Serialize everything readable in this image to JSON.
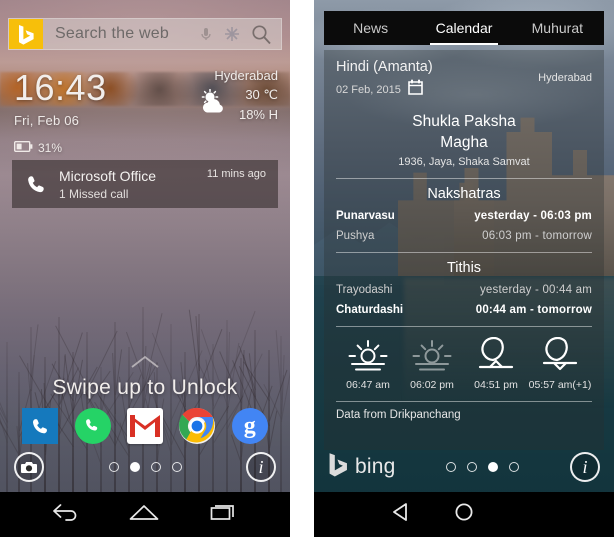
{
  "left_phone": {
    "search": {
      "placeholder": "Search the web",
      "logo": "bing-logo"
    },
    "clock": {
      "time": "16:43",
      "date": "Fri, Feb 06",
      "battery": "31%"
    },
    "weather": {
      "city": "Hyderabad",
      "temperature": "30 ℃",
      "humidity": "18% H",
      "icon": "sun-behind-cloud-icon"
    },
    "notification": {
      "title": "Microsoft Office",
      "subtitle": "1 Missed call",
      "time": "11 mins ago",
      "icon": "phone-icon"
    },
    "unlock_text": "Swipe up to Unlock",
    "apps": [
      {
        "name": "phone",
        "label": "Phone"
      },
      {
        "name": "whatsapp",
        "label": "WhatsApp"
      },
      {
        "name": "gmail",
        "label": "Gmail"
      },
      {
        "name": "chrome",
        "label": "Chrome"
      },
      {
        "name": "google",
        "label": "Google"
      }
    ],
    "bottom": {
      "left_icon": "camera-icon",
      "right_icon": "info-icon",
      "dots": 4,
      "active_dot": 2
    },
    "navbar": {
      "back": "back-icon",
      "home": "home-icon",
      "recents": "recents-icon"
    }
  },
  "right_phone": {
    "tabs": [
      {
        "label": "News",
        "active": false
      },
      {
        "label": "Calendar",
        "active": true
      },
      {
        "label": "Muhurat",
        "active": false
      }
    ],
    "panchang": {
      "language": "Hindi (Amanta)",
      "date": "02 Feb, 2015",
      "calendar_icon": "calendar-icon",
      "city": "Hyderabad",
      "paksha": "Shukla Paksha",
      "month": "Magha",
      "samvat": "1936, Jaya, Shaka Samvat",
      "nakshatras_title": "Nakshatras",
      "nakshatras": [
        {
          "name": "Punarvasu",
          "time": "yesterday  -  06:03 pm",
          "highlight": true
        },
        {
          "name": "Pushya",
          "time": "06:03 pm  -  tomorrow",
          "highlight": false
        }
      ],
      "tithis_title": "Tithis",
      "tithis": [
        {
          "name": "Trayodashi",
          "time": "yesterday  -  00:44 am",
          "highlight": false
        },
        {
          "name": "Chaturdashi",
          "time": "00:44 am  -  tomorrow",
          "highlight": true
        }
      ],
      "astro": [
        {
          "icon": "sunrise-icon",
          "time": "06:47 am"
        },
        {
          "icon": "sunset-icon",
          "time": "06:02 pm"
        },
        {
          "icon": "moonrise-icon",
          "time": "04:51 pm"
        },
        {
          "icon": "moonset-icon",
          "time": "05:57 am(+1)"
        }
      ],
      "source": "Data from Drikpanchang"
    },
    "bottom": {
      "brand": "bing",
      "brand_icon": "bing-logo",
      "right_icon": "info-icon",
      "dots": 4,
      "active_dot": 3
    },
    "navbar": {
      "back": "back-triangle-icon",
      "home": "home-circle-icon"
    }
  },
  "colors": {
    "bing_yellow": "#f7bf0a",
    "whatsapp_green": "#25d366",
    "gmail_red": "#d93025",
    "google_blue": "#4285f4",
    "phone_blue": "#1579bd"
  }
}
